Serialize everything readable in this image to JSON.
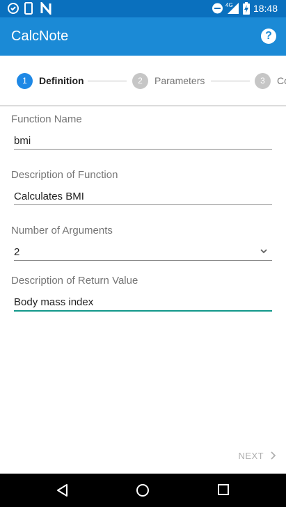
{
  "status_bar": {
    "time": "18:48",
    "network_label": "4G",
    "left_icons": [
      "clock-check-icon",
      "phone-icon",
      "n-icon"
    ],
    "right_icons": [
      "do-not-disturb-icon",
      "signal-icon",
      "battery-charging-icon"
    ]
  },
  "app_bar": {
    "title": "CalcNote",
    "help_icon": "help-circle-icon",
    "background": "#1b8ad6"
  },
  "stepper": {
    "steps": [
      {
        "number": "1",
        "label": "Definition",
        "active": true
      },
      {
        "number": "2",
        "label": "Parameters",
        "active": false
      },
      {
        "number": "3",
        "label": "Co",
        "active": false
      }
    ],
    "active_color": "#1e88e5",
    "inactive_color": "#c6c6c6"
  },
  "form": {
    "function_name": {
      "label": "Function Name",
      "value": "bmi"
    },
    "description": {
      "label": "Description of Function",
      "value": "Calculates BMI"
    },
    "num_args": {
      "label": "Number of Arguments",
      "value": "2"
    },
    "return_desc": {
      "label": "Description of Return Value",
      "value": "Body mass index"
    },
    "focus_color": "#11988a"
  },
  "footer": {
    "next_label": "NEXT"
  },
  "nav_bar": {
    "icons": [
      "back-icon",
      "home-icon",
      "recents-icon"
    ]
  }
}
